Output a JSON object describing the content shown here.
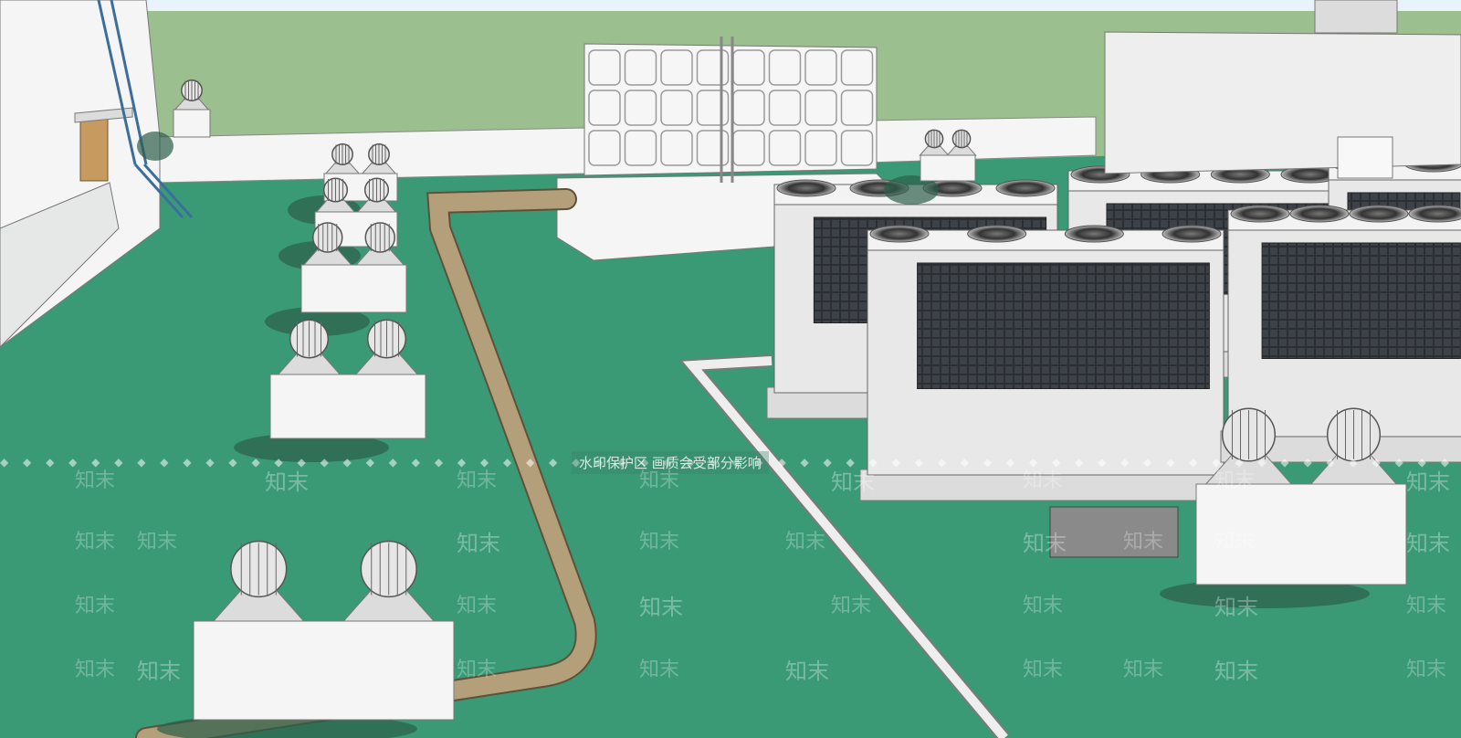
{
  "scene": {
    "description_visible": false,
    "sky_color": "#e9f3fb",
    "horizon_green": "#9bbf8e",
    "roof_green": "#3a9a76",
    "wall_white": "#f4f5f4",
    "pipe_tan": "#b3a07b",
    "unit_gray": "#e2e2e2",
    "grille_dark": "#2b2e33",
    "shadow": "#2c5e4a"
  },
  "watermark": {
    "notice": "水印保护区  画质会受部分影响",
    "dots": "◆ ◆ ◆ ◆ ◆ ◆ ◆ ◆ ◆ ◆ ◆ ◆ ◆ ◆ ◆ ◆ ◆ ◆ ◆ ◆ ◆ ◆ ◆ ◆ ◆ ◆ ◆ ◆ ◆ ◆ ◆ ◆ ◆ ◆ ◆ ◆ ◆ ◆ ◆ ◆ ◆ ◆ ◆ ◆ ◆ ◆ ◆ ◆ ◆ ◆ ◆ ◆ ◆ ◆ ◆ ◆ ◆ ◆ ◆ ◆ ◆ ◆ ◆ ◆ ◆ ◆ ◆ ◆ ◆ ◆ ◆ ◆ ◆ ◆",
    "brand": "知末"
  }
}
